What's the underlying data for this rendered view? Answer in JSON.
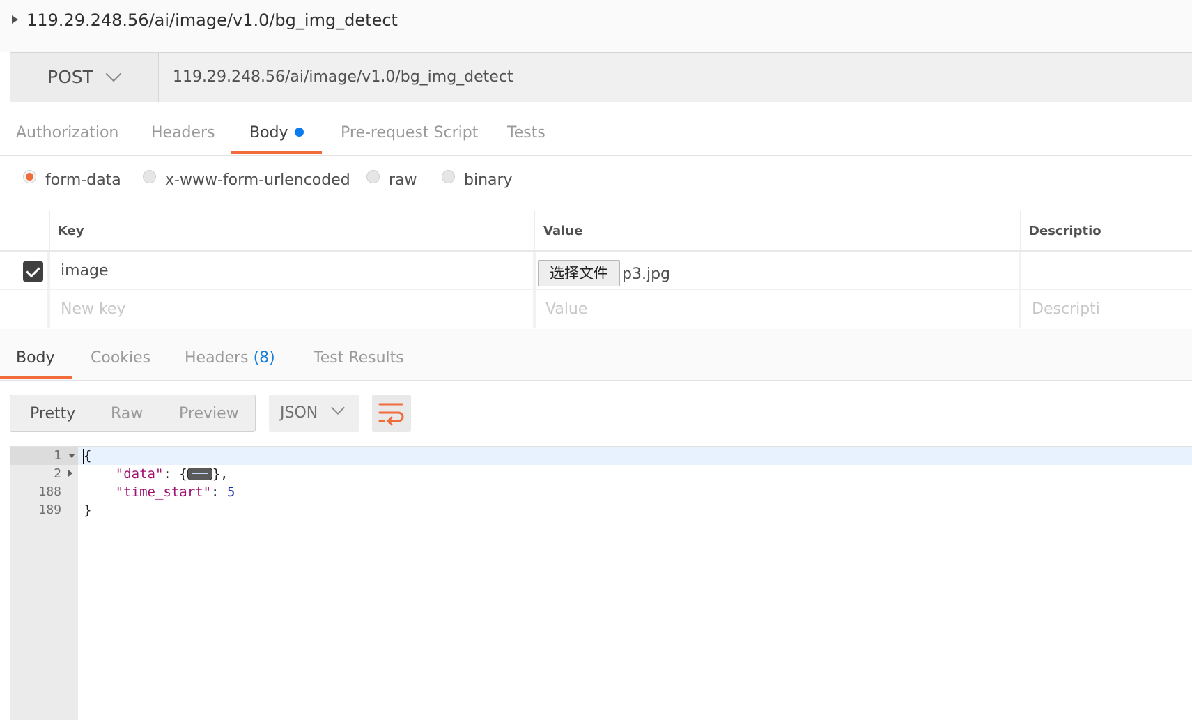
{
  "window": {
    "title": "119.29.248.56/ai/image/v1.0/bg_img_detect"
  },
  "request": {
    "method": "POST",
    "url": "119.29.248.56/ai/image/v1.0/bg_img_detect",
    "tabs": [
      "Authorization",
      "Headers",
      "Body",
      "Pre-request Script",
      "Tests"
    ],
    "active_tab": "Body"
  },
  "body_types": [
    "form-data",
    "x-www-form-urlencoded",
    "raw",
    "binary"
  ],
  "selected_body_type": "form-data",
  "form_table": {
    "headers": {
      "key": "Key",
      "value": "Value",
      "description": "Descriptio"
    },
    "rows": [
      {
        "checked": true,
        "key": "image",
        "file_button": "选择文件",
        "file_name": "p3.jpg"
      }
    ],
    "new_row": {
      "key_placeholder": "New key",
      "value_placeholder": "Value",
      "description_placeholder": "Descripti"
    }
  },
  "response": {
    "tabs": {
      "body": "Body",
      "cookies": "Cookies",
      "headers": "Headers",
      "headers_count": "(8)",
      "tests": "Test Results"
    },
    "active_tab": "Body",
    "view_modes": [
      "Pretty",
      "Raw",
      "Preview"
    ],
    "active_view": "Pretty",
    "format": "JSON",
    "wrap_icon": "wrap-lines-icon"
  },
  "code_lines": [
    {
      "num": "1",
      "text": "{"
    },
    {
      "num": "2",
      "key": "\"data\"",
      "rest": ": {",
      "rest2": "},"
    },
    {
      "num": "188",
      "key": "\"time_start\"",
      "rest": ": ",
      "value": "5"
    },
    {
      "num": "189",
      "text": "}"
    }
  ],
  "colors": {
    "accent": "#f26b3a",
    "dot": "#0b7cf0",
    "json_key": "#a01070",
    "json_number": "#1a2fb0"
  }
}
